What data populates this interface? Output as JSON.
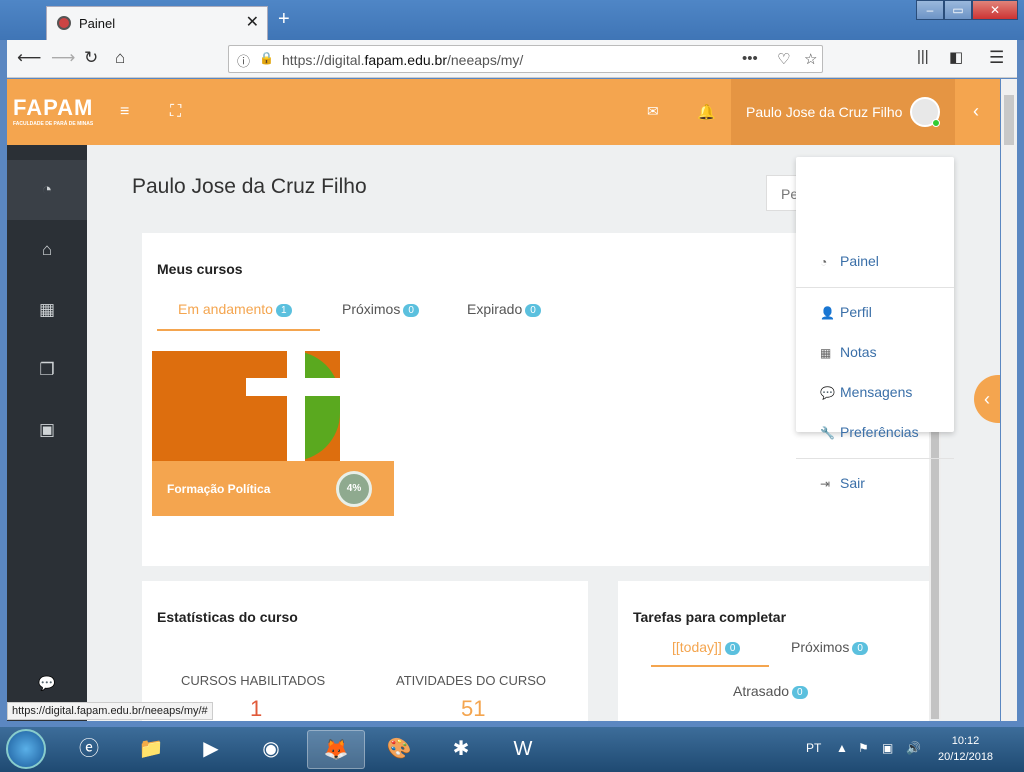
{
  "browser": {
    "tab_title": "Painel",
    "tab_close": "✕",
    "new_tab": "+",
    "url_prefix": "https://digital.",
    "url_domain": "fapam.edu.br",
    "url_path": "/neeaps/my/",
    "status_url": "https://digital.fapam.edu.br/neeaps/my/#"
  },
  "header": {
    "logo_text": "FAPAM",
    "logo_sub": "FACULDADE DE PARÁ DE MINAS",
    "user_name": "Paulo Jose da Cruz Filho"
  },
  "page": {
    "title": "Paulo Jose da Cruz Filho",
    "partial_button": "Pe"
  },
  "courses": {
    "heading": "Meus cursos",
    "tabs": [
      {
        "label": "Em andamento",
        "count": "1"
      },
      {
        "label": "Próximos",
        "count": "0"
      },
      {
        "label": "Expirado",
        "count": "0"
      }
    ],
    "items": [
      {
        "name": "Formação Política",
        "progress": "4%"
      }
    ]
  },
  "stats": {
    "heading": "Estatísticas do curso",
    "enabled_label": "CURSOS HABILITADOS",
    "enabled_value": "1",
    "activities_label": "ATIVIDADES DO CURSO",
    "activities_value": "51"
  },
  "tasks": {
    "heading": "Tarefas para completar",
    "tabs": [
      {
        "label": "[[today]]",
        "count": "0"
      },
      {
        "label": "Próximos",
        "count": "0"
      },
      {
        "label": "Atrasado",
        "count": "0"
      }
    ]
  },
  "user_menu": {
    "items": [
      "Painel",
      "Perfil",
      "Notas",
      "Mensagens",
      "Preferências",
      "Sair"
    ]
  },
  "taskbar": {
    "lang": "PT",
    "time": "10:12",
    "date": "20/12/2018"
  },
  "colors": {
    "accent": "#f4a54f",
    "sidebar": "#2b3036",
    "badge": "#5bc0de"
  }
}
